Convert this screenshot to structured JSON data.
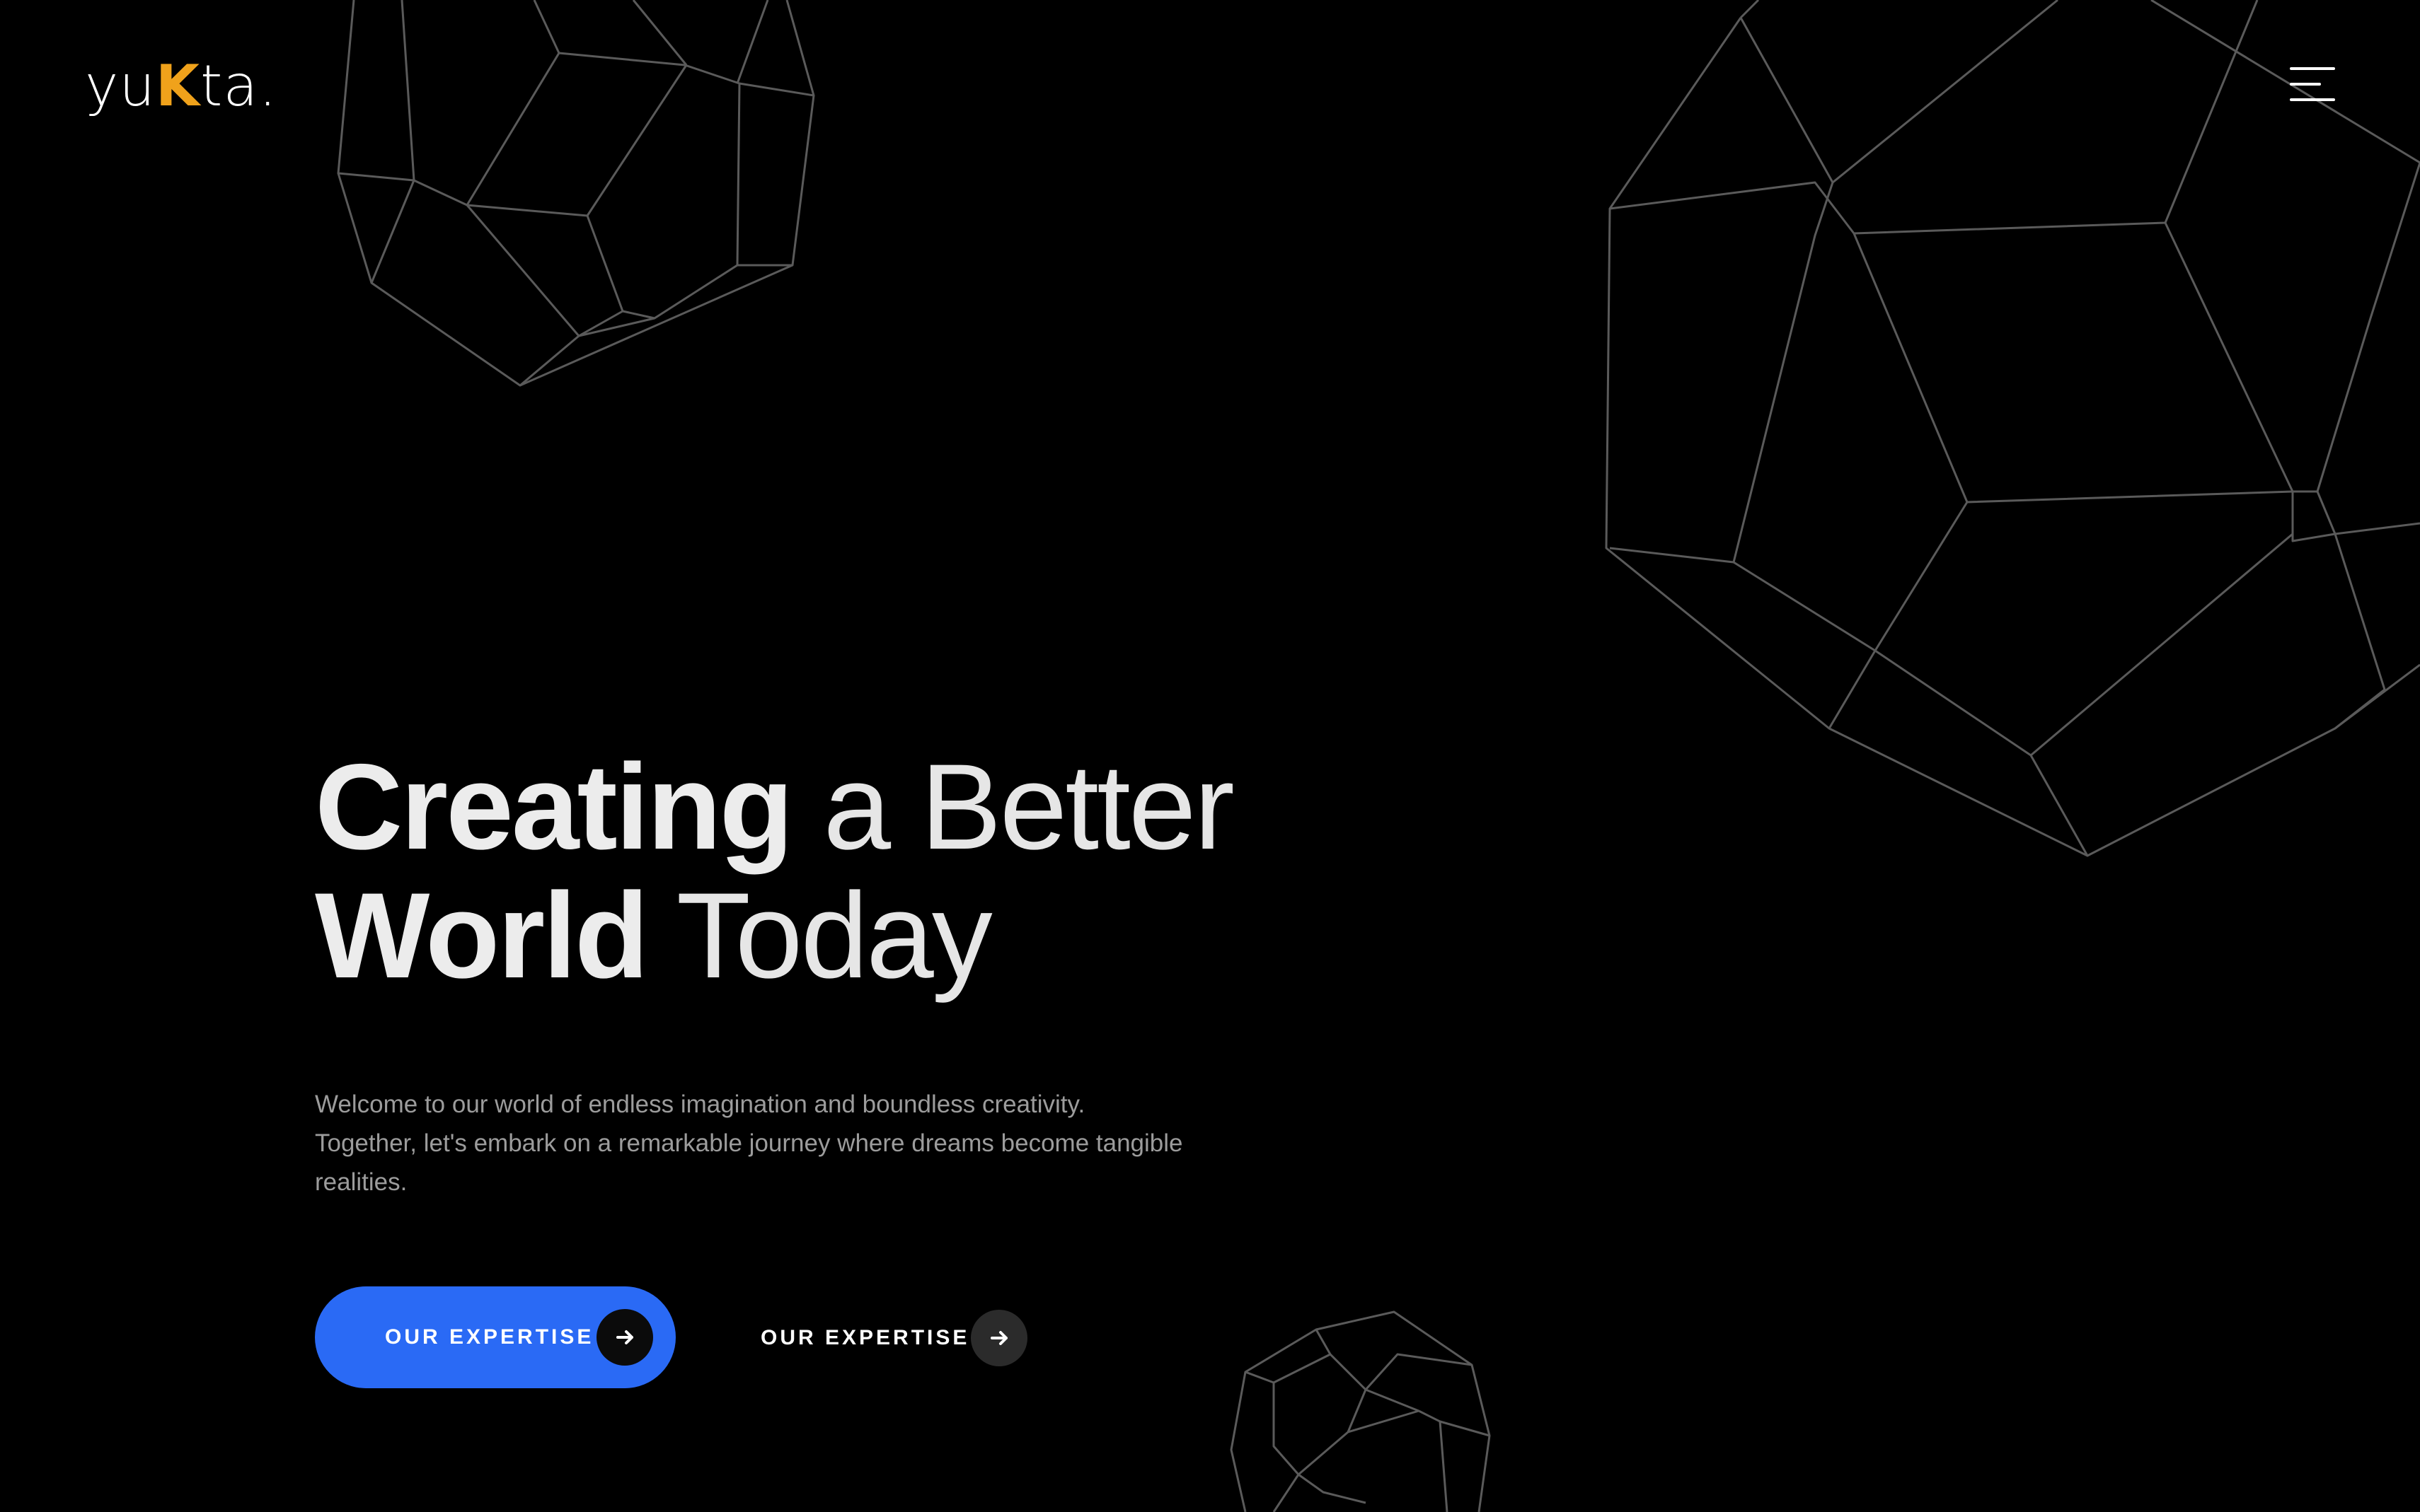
{
  "header": {
    "logo": {
      "prefix": "yu",
      "accent_letter": "K",
      "suffix": "ta."
    },
    "menu_icon": "hamburger-menu-icon"
  },
  "hero": {
    "headline_line1_bold": "Creating",
    "headline_line1_light": " a Better",
    "headline_line2_bold": "World",
    "headline_line2_light": " Today",
    "intro_line1": "Welcome to our world of endless imagination and boundless creativity.",
    "intro_line2": "Together, let's embark on a remarkable journey where dreams become tangible",
    "intro_line3": "realities."
  },
  "actions": {
    "primary_label": "OUR EXPERTISE",
    "secondary_label": "OUR EXPERTISE",
    "arrow_icon": "arrow-right-icon"
  },
  "colors": {
    "background": "#000000",
    "logo_accent": "#f0a21b",
    "primary_button": "#2a6af5",
    "wireframe_stroke": "#5a5a5a"
  },
  "decorations": [
    "dodecahedron-wireframe-top-left",
    "dodecahedron-wireframe-top-right",
    "dodecahedron-wireframe-bottom-center"
  ]
}
